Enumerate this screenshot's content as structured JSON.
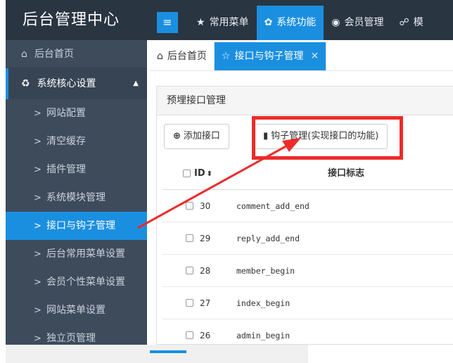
{
  "header": {
    "brand": "后台管理中心",
    "toggle_icon": "menu-icon",
    "nav": [
      {
        "label": "常用菜单",
        "icon": "★"
      },
      {
        "label": "系统功能",
        "icon": "✿",
        "active": true
      },
      {
        "label": "会员管理",
        "icon": "◉"
      },
      {
        "label": "模",
        "icon": "☍"
      }
    ]
  },
  "sidebar": {
    "home": {
      "label": "后台首页",
      "icon": "⌂"
    },
    "group": {
      "label": "系统核心设置",
      "icon": "♻",
      "caret": "▲"
    },
    "items": [
      {
        "label": "网站配置"
      },
      {
        "label": "清空缓存"
      },
      {
        "label": "插件管理"
      },
      {
        "label": "系统模块管理"
      },
      {
        "label": "接口与钩子管理",
        "active": true
      },
      {
        "label": "后台常用菜单设置"
      },
      {
        "label": "会员个性菜单设置"
      },
      {
        "label": "网站菜单设置"
      },
      {
        "label": "独立页管理"
      }
    ]
  },
  "tabs": [
    {
      "label": "后台首页",
      "icon": "⌂"
    },
    {
      "label": "接口与钩子管理",
      "icon": "☆",
      "active": true,
      "close": "✕"
    }
  ],
  "panel": {
    "title": "预埋接口管理",
    "add_button": "添加接口",
    "add_icon": "⊕",
    "hook_button": "钩子管理(实现接口的功能)",
    "hook_icon": "▮"
  },
  "table": {
    "col_id": "ID",
    "col_sort": "⬍",
    "col_name": "接口标志",
    "rows": [
      {
        "id": "30",
        "name": "comment_add_end"
      },
      {
        "id": "29",
        "name": "reply_add_end"
      },
      {
        "id": "28",
        "name": "member_begin"
      },
      {
        "id": "27",
        "name": "index_begin"
      },
      {
        "id": "26",
        "name": "admin_begin"
      }
    ]
  },
  "colors": {
    "accent": "#1a8fe0",
    "header_bg": "#2a3542",
    "sidebar_bg": "#3d4b5b",
    "annotation": "#ee2b2b"
  }
}
